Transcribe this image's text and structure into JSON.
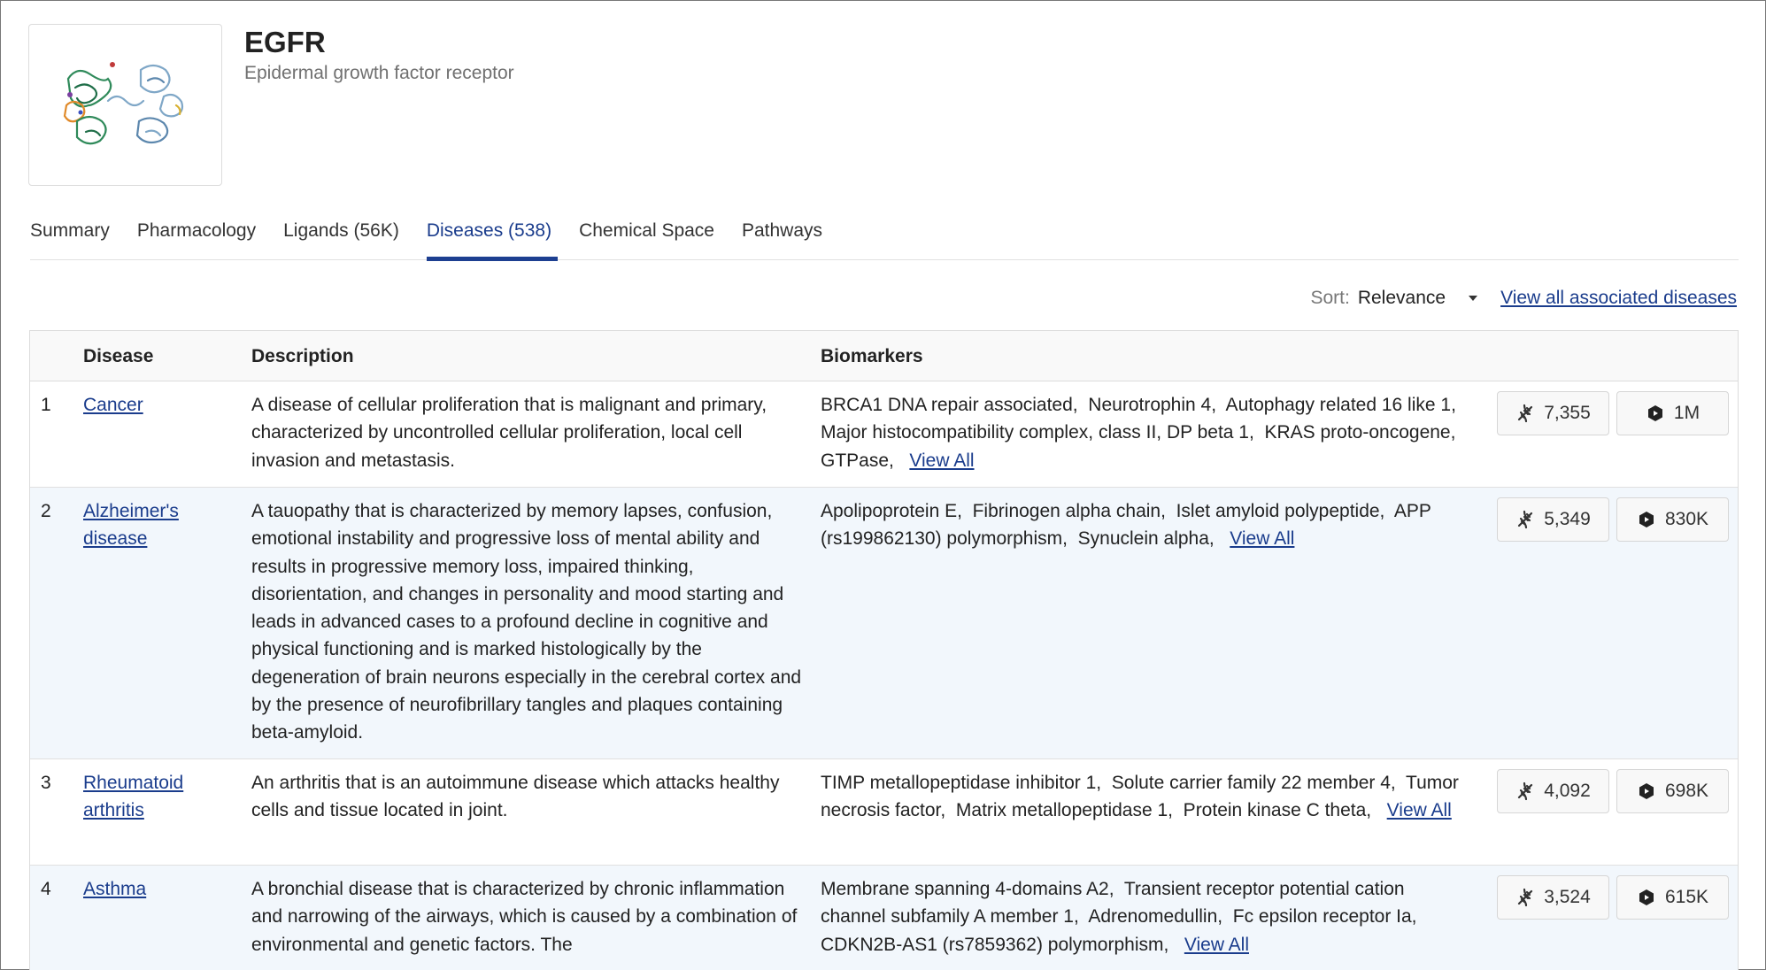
{
  "header": {
    "title": "EGFR",
    "subtitle": "Epidermal growth factor receptor"
  },
  "tabs": [
    {
      "label": "Summary"
    },
    {
      "label": "Pharmacology"
    },
    {
      "label": "Ligands (56K)"
    },
    {
      "label": "Diseases (538)"
    },
    {
      "label": "Chemical Space"
    },
    {
      "label": "Pathways"
    }
  ],
  "active_tab": "Diseases (538)",
  "sort": {
    "label": "Sort:",
    "value": "Relevance",
    "view_all_link": "View all associated diseases"
  },
  "table": {
    "headers": [
      "Disease",
      "Description",
      "Biomarkers"
    ],
    "rows": [
      {
        "num": "1",
        "disease": "Cancer",
        "description": "A disease of cellular proliferation that is malignant and primary, characterized by uncontrolled cellular proliferation, local cell invasion and metastasis.",
        "biomarkers": "BRCA1 DNA repair associated,  Neurotrophin 4,  Autophagy related 16 like 1,  Major histocompatibility complex, class II, DP beta 1,  KRAS proto-oncogene, GTPase,",
        "view_all": "View All",
        "count_a": "7,355",
        "count_b": "1M"
      },
      {
        "num": "2",
        "disease": "Alzheimer's disease",
        "description": "A tauopathy that is characterized by memory lapses, confusion, emotional instability and progressive loss of mental ability and results in progressive memory loss, impaired thinking, disorientation, and changes in personality and mood starting and leads in advanced cases to a profound decline in cognitive and physical functioning and is marked histologically by the degeneration of brain neurons especially in the cerebral cortex and by the presence of neurofibrillary tangles and plaques containing beta-amyloid.",
        "biomarkers": "Apolipoprotein E,  Fibrinogen alpha chain,  Islet amyloid polypeptide,  APP (rs199862130) polymorphism,  Synuclein alpha,",
        "view_all": "View All",
        "count_a": "5,349",
        "count_b": "830K"
      },
      {
        "num": "3",
        "disease": "Rheumatoid arthritis",
        "description": "An arthritis that is an autoimmune disease which attacks healthy cells and tissue located in joint.",
        "biomarkers": "TIMP metallopeptidase inhibitor 1,  Solute carrier family 22 member 4,  Tumor necrosis factor,  Matrix metallopeptidase 1,  Protein kinase C theta,",
        "view_all": "View All",
        "count_a": "4,092",
        "count_b": "698K"
      },
      {
        "num": "4",
        "disease": "Asthma",
        "description": "A bronchial disease that is characterized by chronic inflammation and narrowing of the airways, which is caused by a combination of environmental and genetic factors. The",
        "biomarkers": "Membrane spanning 4-domains A2,  Transient receptor potential cation channel subfamily A member 1,  Adrenomedullin,  Fc epsilon receptor Ia,  CDKN2B-AS1 (rs7859362) polymorphism,",
        "view_all": "View All",
        "count_a": "3,524",
        "count_b": "615K"
      }
    ]
  },
  "icons": {
    "count_a_icon": "dna-icon",
    "count_b_icon": "molecule-icon"
  },
  "colors": {
    "accent": "#1d3f91",
    "link": "#1a3c8c",
    "row_alt": "#f2f7fc"
  }
}
